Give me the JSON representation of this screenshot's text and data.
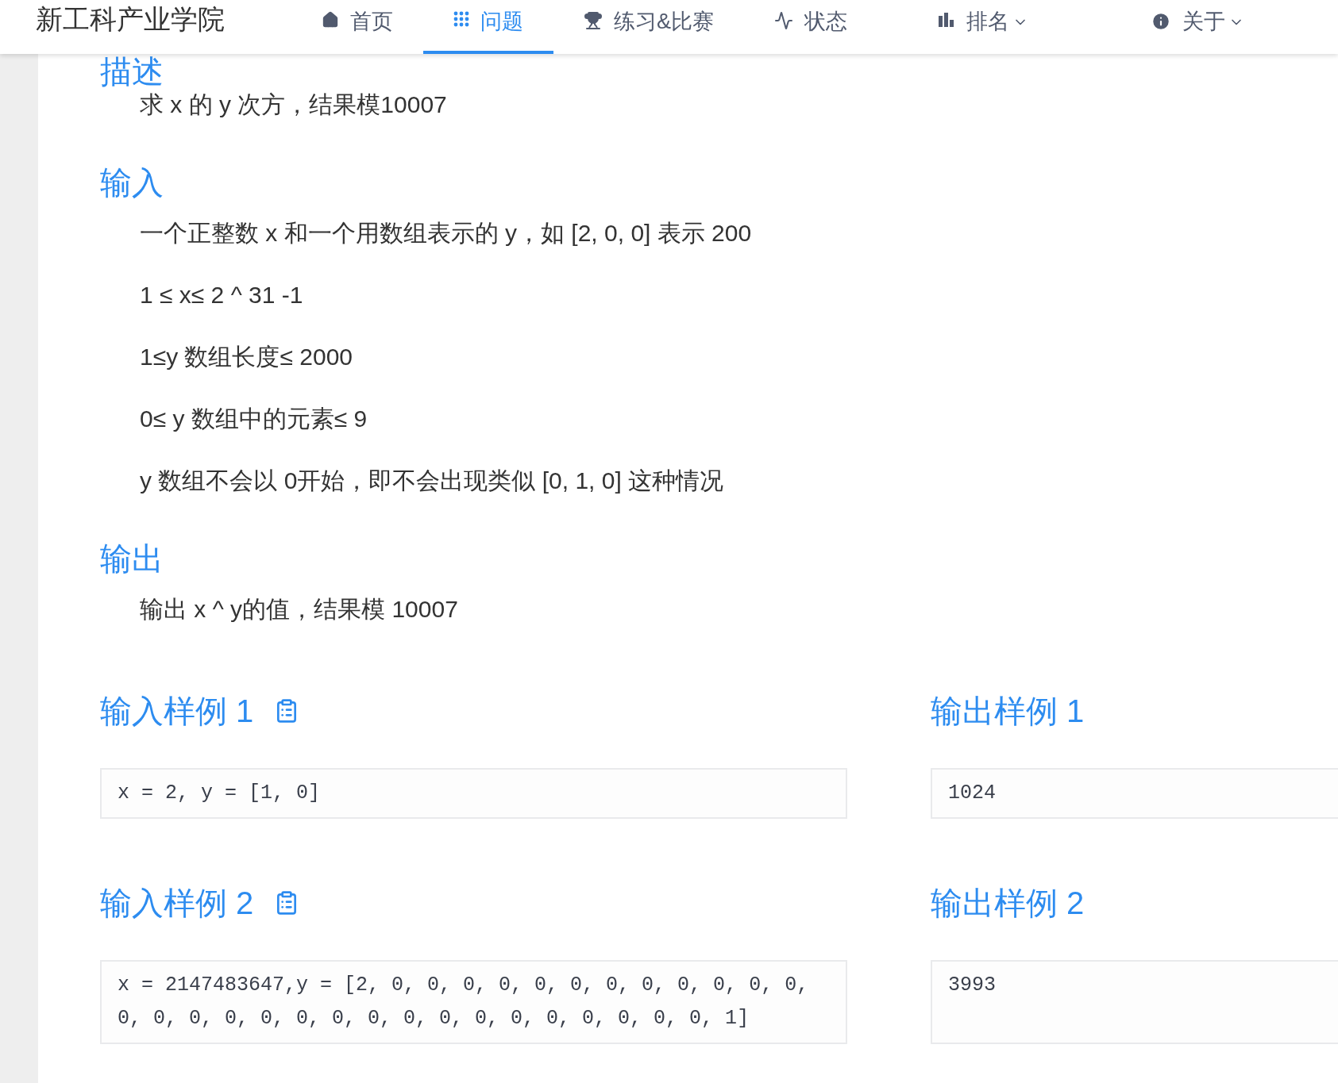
{
  "header": {
    "title": "新工科产业学院",
    "menu": [
      {
        "label": "首页",
        "kind": "home",
        "selected": false,
        "dropdown": false
      },
      {
        "label": "问题",
        "kind": "grid",
        "selected": true,
        "dropdown": false
      },
      {
        "label": "练习&比赛",
        "kind": "trophy",
        "selected": false,
        "dropdown": false
      },
      {
        "label": "状态",
        "kind": "pulse",
        "selected": false,
        "dropdown": false
      },
      {
        "label": "排名",
        "kind": "bars",
        "selected": false,
        "dropdown": true
      },
      {
        "label": "关于",
        "kind": "info",
        "selected": false,
        "dropdown": true
      }
    ]
  },
  "sections": [
    {
      "title": "描述",
      "paragraphs": [
        "求 x 的 y 次方，结果模10007"
      ]
    },
    {
      "title": "输入",
      "paragraphs": [
        "一个正整数 x 和一个用数组表示的 y，如 [2, 0, 0] 表示 200",
        "1 ≤ x≤ 2 ^ 31 -1",
        "1≤y 数组长度≤ 2000",
        "0≤ y 数组中的元素≤ 9",
        "y 数组不会以 0开始，即不会出现类似 [0, 1, 0] 这种情况"
      ]
    },
    {
      "title": "输出",
      "paragraphs": [
        "输出 x ^ y的值，结果模 10007"
      ]
    }
  ],
  "samples": [
    {
      "input_title": "输入样例 1",
      "input": "x = 2, y = [1, 0]",
      "output_title": "输出样例 1",
      "output": "1024"
    },
    {
      "input_title": "输入样例 2",
      "input": "x = 2147483647,y = [2, 0, 0, 0, 0, 0, 0, 0, 0, 0, 0, 0, 0, 0, 0, 0, 0, 0, 0, 0, 0, 0, 0, 0, 0, 0, 0, 0, 0, 0, 1]",
      "output_title": "输出样例 2",
      "output": "3993"
    }
  ]
}
